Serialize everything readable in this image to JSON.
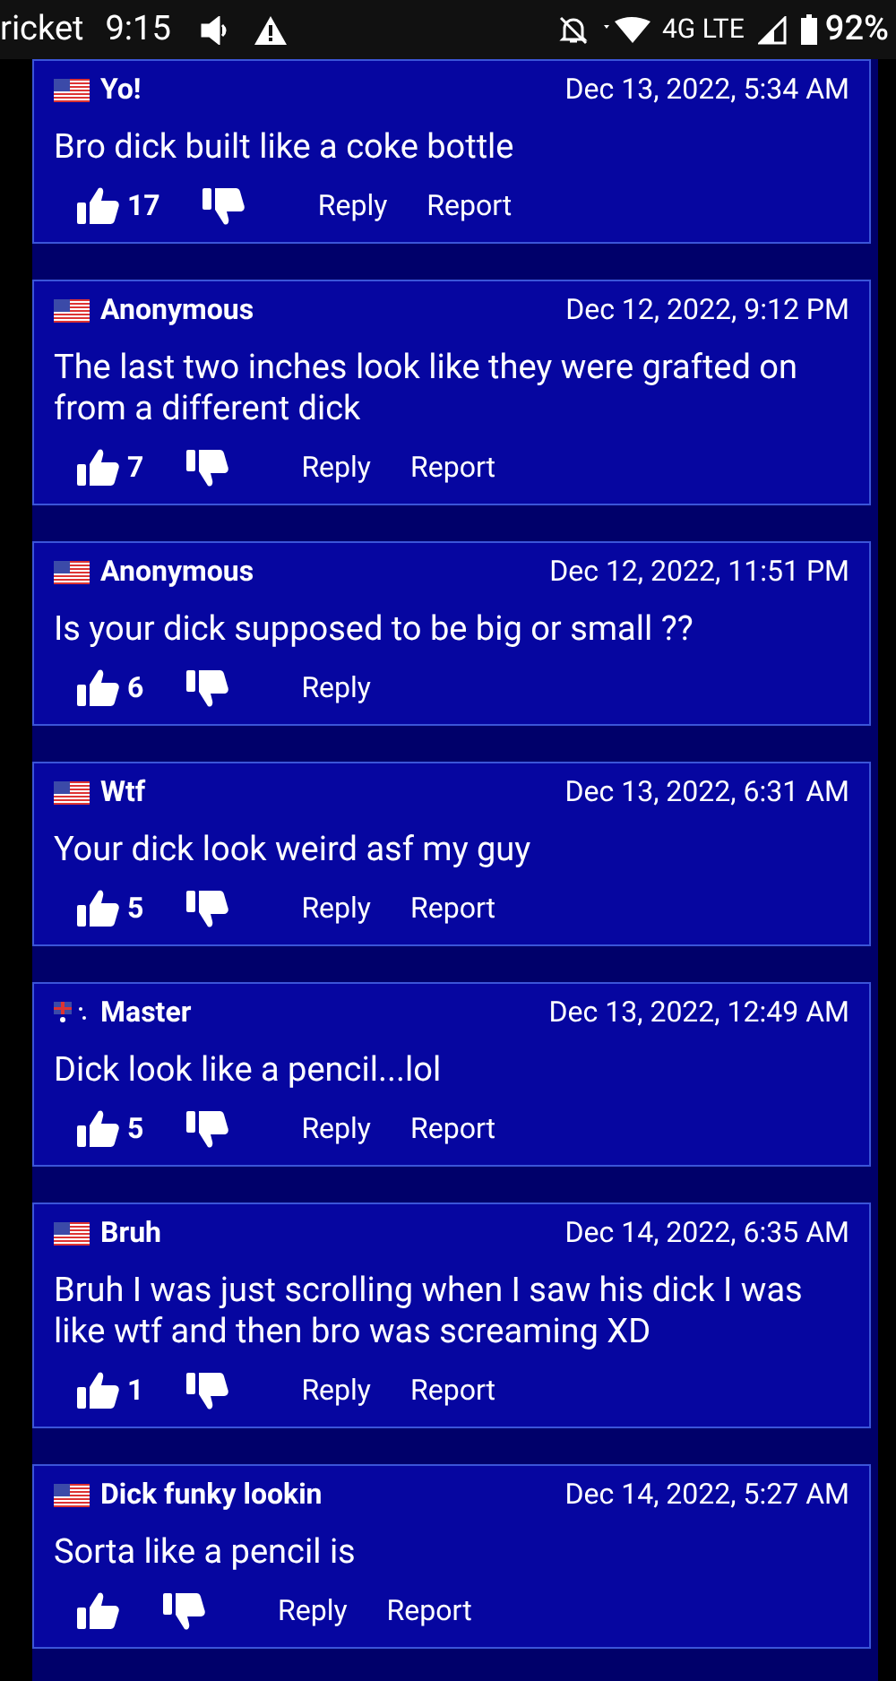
{
  "status_bar": {
    "carrier": "ricket",
    "time": "9:15",
    "network": "4G LTE",
    "battery": "92%"
  },
  "comments": [
    {
      "kind": "us",
      "name": "Yo!",
      "date": "Dec 13, 2022, 5:34 AM",
      "text": "Bro dick built like a coke bottle",
      "likes": "17",
      "actions": [
        "Reply",
        "Report"
      ]
    },
    {
      "kind": "us",
      "name": "Anonymous",
      "date": "Dec 12, 2022, 9:12 PM",
      "text": "The last two inches look like they were grafted on from a different dick",
      "likes": "7",
      "actions": [
        "Reply",
        "Report"
      ]
    },
    {
      "kind": "us",
      "name": "Anonymous",
      "date": "Dec 12, 2022, 11:51 PM",
      "text": "Is your dick supposed to be big or small ??",
      "likes": "6",
      "actions": [
        "Reply"
      ]
    },
    {
      "kind": "us",
      "name": "Wtf",
      "date": "Dec 13, 2022, 6:31 AM",
      "text": "Your dick look weird asf my guy",
      "likes": "5",
      "actions": [
        "Reply",
        "Report"
      ]
    },
    {
      "kind": "au",
      "name": "Master",
      "date": "Dec 13, 2022, 12:49 AM",
      "text": "Dick look like a pencil...lol",
      "likes": "5",
      "actions": [
        "Reply",
        "Report"
      ]
    },
    {
      "kind": "us",
      "name": "Bruh",
      "date": "Dec 14, 2022, 6:35 AM",
      "text": "Bruh I was just scrolling when I saw his dick I was like wtf and then bro was screaming XD",
      "likes": "1",
      "actions": [
        "Reply",
        "Report"
      ]
    },
    {
      "kind": "us",
      "name": "Dick funky lookin",
      "date": "Dec 14, 2022, 5:27 AM",
      "text": "Sorta like a pencil is",
      "actions": [
        "Reply",
        "Report"
      ]
    }
  ]
}
